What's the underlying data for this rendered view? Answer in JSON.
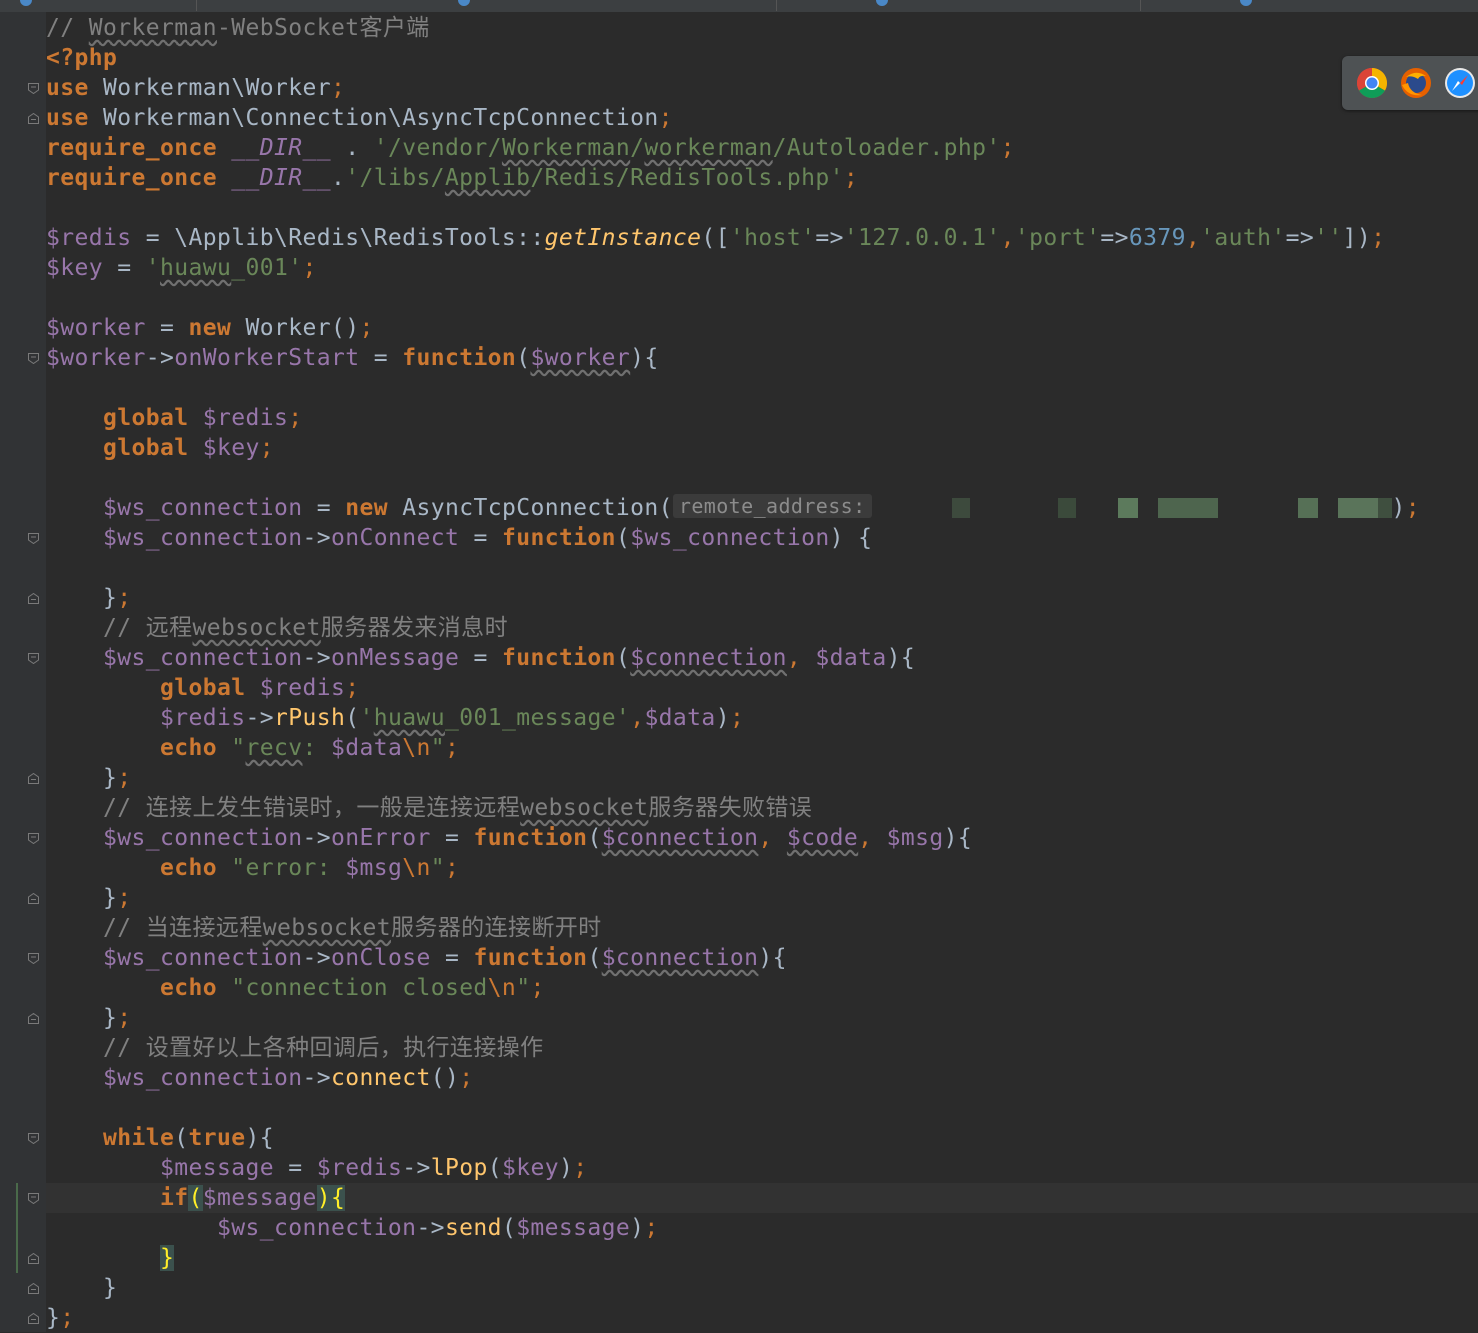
{
  "editor": {
    "language": "php",
    "current_line_index": 39,
    "lines": [
      [
        [
          "c",
          "// "
        ],
        [
          "c sq",
          "Workerman"
        ],
        [
          "c",
          "-WebSocket客户端"
        ]
      ],
      [
        [
          "k",
          "<?php"
        ]
      ],
      [
        [
          "k",
          "use "
        ],
        [
          "tx",
          "Workerman\\Worker"
        ],
        [
          "kn",
          ";"
        ]
      ],
      [
        [
          "k",
          "use "
        ],
        [
          "tx",
          "Workerman\\Connection\\AsyncTcpConnection"
        ],
        [
          "kn",
          ";"
        ]
      ],
      [
        [
          "k",
          "require_once "
        ],
        [
          "it",
          "__DIR__"
        ],
        [
          "tx",
          " . "
        ],
        [
          "s",
          "'/vendor/"
        ],
        [
          "s sq",
          "Workerman"
        ],
        [
          "s",
          "/"
        ],
        [
          "s sq",
          "workerman"
        ],
        [
          "s",
          "/Autoloader.php'"
        ],
        [
          "kn",
          ";"
        ]
      ],
      [
        [
          "k",
          "require_once "
        ],
        [
          "it",
          "__DIR__"
        ],
        [
          "tx",
          "."
        ],
        [
          "s",
          "'/libs/"
        ],
        [
          "s sq",
          "Applib"
        ],
        [
          "s",
          "/Redis/RedisTools.php'"
        ],
        [
          "kn",
          ";"
        ]
      ],
      [],
      [
        [
          "v",
          "$redis"
        ],
        [
          "tx",
          " = \\Applib\\Redis\\RedisTools::"
        ],
        [
          "fi",
          "getInstance"
        ],
        [
          "tx",
          "(["
        ],
        [
          "s",
          "'host'"
        ],
        [
          "tx",
          "=>"
        ],
        [
          "s",
          "'127.0.0.1'"
        ],
        [
          "kn",
          ","
        ],
        [
          "s",
          "'port'"
        ],
        [
          "tx",
          "=>"
        ],
        [
          "n",
          "6379"
        ],
        [
          "kn",
          ","
        ],
        [
          "s",
          "'auth'"
        ],
        [
          "tx",
          "=>"
        ],
        [
          "s",
          "''"
        ],
        [
          "tx",
          "])"
        ],
        [
          "kn",
          ";"
        ]
      ],
      [
        [
          "v",
          "$key"
        ],
        [
          "tx",
          " = "
        ],
        [
          "s",
          "'"
        ],
        [
          "s sq",
          "huawu"
        ],
        [
          "s",
          "_001'"
        ],
        [
          "kn",
          ";"
        ]
      ],
      [],
      [
        [
          "v",
          "$worker"
        ],
        [
          "tx",
          " = "
        ],
        [
          "k",
          "new "
        ],
        [
          "tx",
          "Worker()"
        ],
        [
          "kn",
          ";"
        ]
      ],
      [
        [
          "v",
          "$worker"
        ],
        [
          "tx",
          "->"
        ],
        [
          "v",
          "onWorkerStart"
        ],
        [
          "tx",
          " = "
        ],
        [
          "k",
          "function"
        ],
        [
          "tx",
          "("
        ],
        [
          "v sq",
          "$worker"
        ],
        [
          "tx",
          "){"
        ]
      ],
      [],
      [
        [
          "tx",
          "    "
        ],
        [
          "k",
          "global "
        ],
        [
          "v",
          "$redis"
        ],
        [
          "kn",
          ";"
        ]
      ],
      [
        [
          "tx",
          "    "
        ],
        [
          "k",
          "global "
        ],
        [
          "v",
          "$key"
        ],
        [
          "kn",
          ";"
        ]
      ],
      [],
      [
        [
          "tx",
          "    "
        ],
        [
          "v",
          "$ws_connection"
        ],
        [
          "tx",
          " = "
        ],
        [
          "k",
          "new "
        ],
        [
          "tx",
          "AsyncTcpConnection("
        ],
        [
          "hint",
          "remote_address:"
        ],
        [
          "blur",
          ""
        ],
        [
          "tx",
          ")"
        ],
        [
          "kn",
          ";"
        ]
      ],
      [
        [
          "tx",
          "    "
        ],
        [
          "v",
          "$ws_connection"
        ],
        [
          "tx",
          "->"
        ],
        [
          "v",
          "onConnect"
        ],
        [
          "tx",
          " = "
        ],
        [
          "k",
          "function"
        ],
        [
          "tx",
          "("
        ],
        [
          "v",
          "$ws_connection"
        ],
        [
          "tx",
          ") {"
        ]
      ],
      [],
      [
        [
          "tx",
          "    }"
        ],
        [
          "kn",
          ";"
        ]
      ],
      [
        [
          "c",
          "    // 远程"
        ],
        [
          "c sq",
          "websocket"
        ],
        [
          "c",
          "服务器发来消息时"
        ]
      ],
      [
        [
          "tx",
          "    "
        ],
        [
          "v",
          "$ws_connection"
        ],
        [
          "tx",
          "->"
        ],
        [
          "v",
          "onMessage"
        ],
        [
          "tx",
          " = "
        ],
        [
          "k",
          "function"
        ],
        [
          "tx",
          "("
        ],
        [
          "v sq",
          "$connection"
        ],
        [
          "kn",
          ", "
        ],
        [
          "v",
          "$data"
        ],
        [
          "tx",
          "){"
        ]
      ],
      [
        [
          "tx",
          "        "
        ],
        [
          "k",
          "global "
        ],
        [
          "v",
          "$redis"
        ],
        [
          "kn",
          ";"
        ]
      ],
      [
        [
          "tx",
          "        "
        ],
        [
          "v",
          "$redis"
        ],
        [
          "tx",
          "->"
        ],
        [
          "fn",
          "rPush"
        ],
        [
          "tx",
          "("
        ],
        [
          "s",
          "'"
        ],
        [
          "s sq",
          "huawu"
        ],
        [
          "s",
          "_001_message'"
        ],
        [
          "kn",
          ","
        ],
        [
          "v",
          "$data"
        ],
        [
          "tx",
          ")"
        ],
        [
          "kn",
          ";"
        ]
      ],
      [
        [
          "tx",
          "        "
        ],
        [
          "k",
          "echo "
        ],
        [
          "s",
          "\""
        ],
        [
          "s sq",
          "recv"
        ],
        [
          "s",
          ": "
        ],
        [
          "v",
          "$data"
        ],
        [
          "kn",
          "\\n"
        ],
        [
          "s",
          "\""
        ],
        [
          "kn",
          ";"
        ]
      ],
      [
        [
          "tx",
          "    }"
        ],
        [
          "kn",
          ";"
        ]
      ],
      [
        [
          "c",
          "    // 连接上发生错误时，一般是连接远程"
        ],
        [
          "c sq",
          "websocket"
        ],
        [
          "c",
          "服务器失败错误"
        ]
      ],
      [
        [
          "tx",
          "    "
        ],
        [
          "v",
          "$ws_connection"
        ],
        [
          "tx",
          "->"
        ],
        [
          "v",
          "onError"
        ],
        [
          "tx",
          " = "
        ],
        [
          "k",
          "function"
        ],
        [
          "tx",
          "("
        ],
        [
          "v sq",
          "$connection"
        ],
        [
          "kn",
          ", "
        ],
        [
          "v sq",
          "$code"
        ],
        [
          "kn",
          ", "
        ],
        [
          "v",
          "$msg"
        ],
        [
          "tx",
          "){"
        ]
      ],
      [
        [
          "tx",
          "        "
        ],
        [
          "k",
          "echo "
        ],
        [
          "s",
          "\"error: "
        ],
        [
          "v",
          "$msg"
        ],
        [
          "kn",
          "\\n"
        ],
        [
          "s",
          "\""
        ],
        [
          "kn",
          ";"
        ]
      ],
      [
        [
          "tx",
          "    }"
        ],
        [
          "kn",
          ";"
        ]
      ],
      [
        [
          "c",
          "    // 当连接远程"
        ],
        [
          "c sq",
          "websocket"
        ],
        [
          "c",
          "服务器的连接断开时"
        ]
      ],
      [
        [
          "tx",
          "    "
        ],
        [
          "v",
          "$ws_connection"
        ],
        [
          "tx",
          "->"
        ],
        [
          "v",
          "onClose"
        ],
        [
          "tx",
          " = "
        ],
        [
          "k",
          "function"
        ],
        [
          "tx",
          "("
        ],
        [
          "v sq",
          "$connection"
        ],
        [
          "tx",
          "){"
        ]
      ],
      [
        [
          "tx",
          "        "
        ],
        [
          "k",
          "echo "
        ],
        [
          "s",
          "\"connection closed"
        ],
        [
          "kn",
          "\\n"
        ],
        [
          "s",
          "\""
        ],
        [
          "kn",
          ";"
        ]
      ],
      [
        [
          "tx",
          "    }"
        ],
        [
          "kn",
          ";"
        ]
      ],
      [
        [
          "c",
          "    // 设置好以上各种回调后，执行连接操作"
        ]
      ],
      [
        [
          "tx",
          "    "
        ],
        [
          "v",
          "$ws_connection"
        ],
        [
          "tx",
          "->"
        ],
        [
          "fn",
          "connect"
        ],
        [
          "tx",
          "()"
        ],
        [
          "kn",
          ";"
        ]
      ],
      [],
      [
        [
          "tx",
          "    "
        ],
        [
          "k",
          "while"
        ],
        [
          "tx",
          "("
        ],
        [
          "k",
          "true"
        ],
        [
          "tx",
          "){"
        ]
      ],
      [
        [
          "tx",
          "        "
        ],
        [
          "v",
          "$message"
        ],
        [
          "tx",
          " = "
        ],
        [
          "v",
          "$redis"
        ],
        [
          "tx",
          "->"
        ],
        [
          "fn",
          "lPop"
        ],
        [
          "tx",
          "("
        ],
        [
          "v",
          "$key"
        ],
        [
          "tx",
          ")"
        ],
        [
          "kn",
          ";"
        ]
      ],
      [
        [
          "tx",
          "        "
        ],
        [
          "k",
          "if"
        ],
        [
          "br",
          "("
        ],
        [
          "v",
          "$message"
        ],
        [
          "br",
          "){"
        ]
      ],
      [
        [
          "tx",
          "            "
        ],
        [
          "v",
          "$ws_connection"
        ],
        [
          "tx",
          "->"
        ],
        [
          "fn",
          "send"
        ],
        [
          "tx",
          "("
        ],
        [
          "v",
          "$message"
        ],
        [
          "tx",
          ")"
        ],
        [
          "kn",
          ";"
        ]
      ],
      [
        [
          "tx",
          "        "
        ],
        [
          "br",
          "}"
        ]
      ],
      [
        [
          "tx",
          "    }"
        ]
      ],
      [
        [
          "tx",
          "}"
        ],
        [
          "kn",
          ";"
        ]
      ]
    ]
  },
  "fold_markers": [
    {
      "line": 2,
      "kind": "start"
    },
    {
      "line": 3,
      "kind": "end"
    },
    {
      "line": 11,
      "kind": "start"
    },
    {
      "line": 17,
      "kind": "start"
    },
    {
      "line": 19,
      "kind": "end"
    },
    {
      "line": 21,
      "kind": "start"
    },
    {
      "line": 25,
      "kind": "end"
    },
    {
      "line": 27,
      "kind": "start"
    },
    {
      "line": 29,
      "kind": "end"
    },
    {
      "line": 31,
      "kind": "start"
    },
    {
      "line": 33,
      "kind": "end"
    },
    {
      "line": 37,
      "kind": "start"
    },
    {
      "line": 39,
      "kind": "start"
    },
    {
      "line": 41,
      "kind": "end"
    },
    {
      "line": 42,
      "kind": "end"
    },
    {
      "line": 43,
      "kind": "end"
    }
  ],
  "browser_icons": [
    "chrome-icon",
    "firefox-icon",
    "safari-icon"
  ],
  "colors": {
    "background": "#2b2b2b",
    "gutter": "#313335",
    "keyword": "#cc7832",
    "variable": "#9876aa",
    "string": "#6a8759",
    "number": "#6897bb",
    "function": "#ffc66d",
    "comment": "#808080",
    "text": "#a9b7c6"
  }
}
